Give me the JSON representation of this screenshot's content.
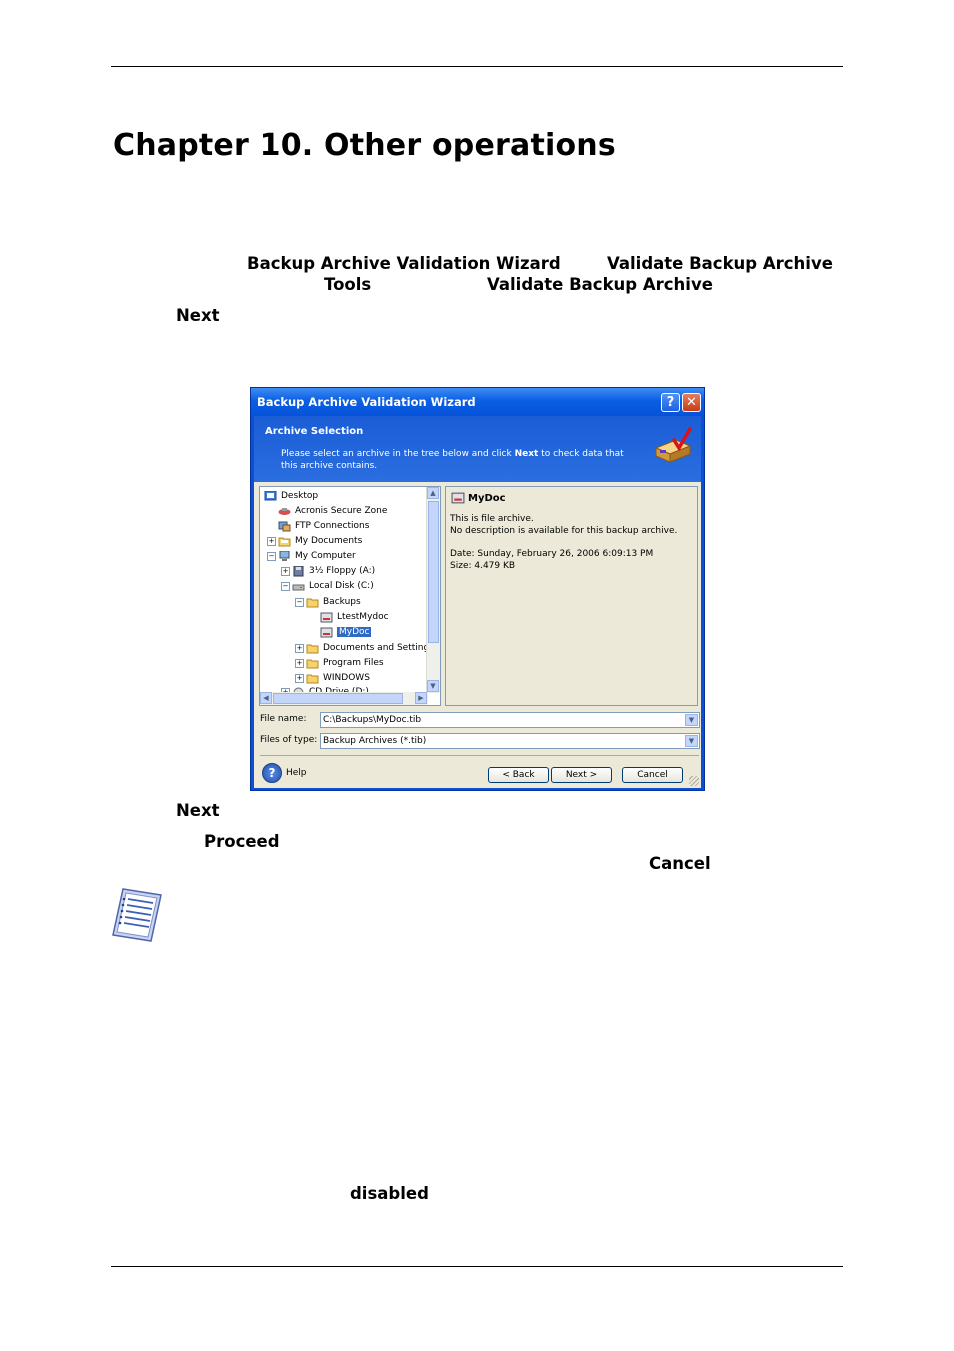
{
  "chapter": {
    "title": "Chapter 10.  Other operations"
  },
  "keywords": {
    "wizard": "Backup Archive Validation Wizard",
    "validate1": "Validate Backup Archive",
    "tools": "Tools",
    "validate2": "Validate Backup Archive",
    "next1": "Next",
    "next2": "Next",
    "proceed": "Proceed",
    "cancel": "Cancel",
    "disabled": "disabled"
  },
  "dialog": {
    "title": "Backup Archive Validation Wizard",
    "banner_title": "Archive Selection",
    "banner_desc_pre": "Please select an archive in the tree below and click ",
    "banner_desc_bold": "Next",
    "banner_desc_post": " to check data that this archive contains.",
    "tree": [
      {
        "label": "Desktop"
      },
      {
        "label": "Acronis Secure Zone"
      },
      {
        "label": "FTP Connections"
      },
      {
        "label": "My Documents"
      },
      {
        "label": "My Computer"
      },
      {
        "label": "3½ Floppy (A:)"
      },
      {
        "label": "Local Disk (C:)"
      },
      {
        "label": "Backups"
      },
      {
        "label": "LtestMydoc"
      },
      {
        "label": "MyDoc"
      },
      {
        "label": "Documents and Setting"
      },
      {
        "label": "Program Files"
      },
      {
        "label": "WINDOWS"
      },
      {
        "label": "CD Drive (D:)"
      }
    ],
    "info": {
      "title": "MyDoc",
      "line1": "This is file archive.",
      "line2": "No description is available for this backup archive.",
      "line3": "Date: Sunday, February 26, 2006 6:09:13 PM",
      "line4": "Size: 4.479 KB"
    },
    "file_name_label": "File name:",
    "file_name_value": "C:\\Backups\\MyDoc.tib",
    "file_type_label": "Files of type:",
    "file_type_value": "Backup Archives (*.tib)",
    "help_label": "Help",
    "back_label": "< Back",
    "next_label": "Next >",
    "cancel_label": "Cancel"
  }
}
